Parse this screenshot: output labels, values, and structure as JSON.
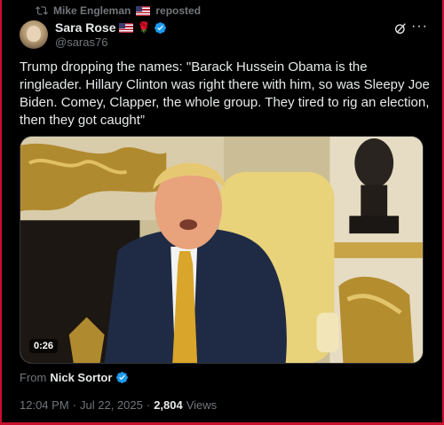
{
  "repost": {
    "user": "Mike Engleman",
    "label": "reposted"
  },
  "author": {
    "name": "Sara Rose",
    "handle": "@saras76"
  },
  "post": {
    "text": "Trump dropping the names: \"Barack Hussein Obama is the ringleader. Hillary Clinton was right there with him, so was Sleepy Joe Biden. Comey, Clapper, the whole group. They tired to rig an election, then they got caught”"
  },
  "media": {
    "duration": "0:26"
  },
  "source": {
    "prefix": "From",
    "name": "Nick Sortor"
  },
  "meta": {
    "time": "12:04 PM",
    "date": "Jul 22, 2025",
    "views_count": "2,804",
    "views_label": "Views"
  },
  "colors": {
    "accent": "#1d9bf0",
    "background": "#000000",
    "muted": "#71767b",
    "frame": "#c8102e"
  },
  "icons": [
    "repost-icon",
    "flag-icon",
    "rose-icon",
    "verified-icon",
    "grok-icon",
    "more-icon"
  ]
}
